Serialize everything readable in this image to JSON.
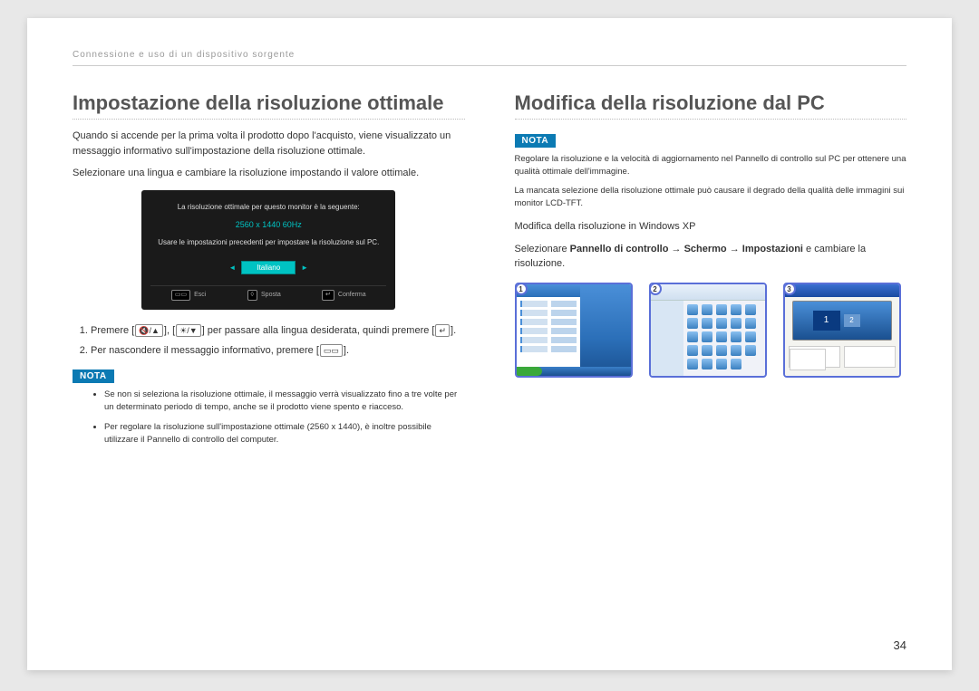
{
  "header": "Connessione e uso di un dispositivo sorgente",
  "left": {
    "title": "Impostazione della risoluzione ottimale",
    "intro1": "Quando si accende per la prima volta il prodotto dopo l'acquisto, viene visualizzato un messaggio informativo sull'impostazione della risoluzione ottimale.",
    "intro2": "Selezionare una lingua e cambiare la risoluzione impostando il valore ottimale.",
    "monitor": {
      "line1": "La risoluzione ottimale per questo monitor è la seguente:",
      "line2": "2560 x 1440 60Hz",
      "line3": "Usare le impostazioni precedenti per impostare la risoluzione sul PC.",
      "lang": "Italiano",
      "esc": "Esci",
      "move": "Sposta",
      "confirm": "Conferma"
    },
    "step1_a": "Premere [",
    "step1_b": "], [",
    "step1_c": "] per passare alla lingua desiderata, quindi premere [",
    "step1_d": "].",
    "step2_a": "Per nascondere il messaggio informativo, premere [",
    "step2_b": "].",
    "nota": "NOTA",
    "bullet1": "Se non si seleziona la risoluzione ottimale, il messaggio verrà visualizzato fino a tre volte per un determinato periodo di tempo, anche se il prodotto viene spento e riacceso.",
    "bullet2": "Per regolare la risoluzione sull'impostazione ottimale (2560 x 1440), è inoltre possibile utilizzare il Pannello di controllo del computer."
  },
  "right": {
    "title": "Modifica della risoluzione dal PC",
    "nota": "NOTA",
    "note1": "Regolare la risoluzione e la velocità di aggiornamento nel Pannello di controllo sul PC per ottenere una qualità ottimale dell'immagine.",
    "note2": "La mancata selezione della risoluzione ottimale può causare il degrado della qualità delle immagini sui monitor LCD-TFT.",
    "subhead": "Modifica della risoluzione in Windows XP",
    "path1": "Selezionare ",
    "path_cp": "Pannello di controllo",
    "path_arrow": " → ",
    "path_display": "Schermo",
    "path_settings": "Impostazioni",
    "path_tail": " e cambiare la risoluzione.",
    "shot1": "1",
    "shot2": "2",
    "shot3": "3"
  },
  "pageNum": "34"
}
